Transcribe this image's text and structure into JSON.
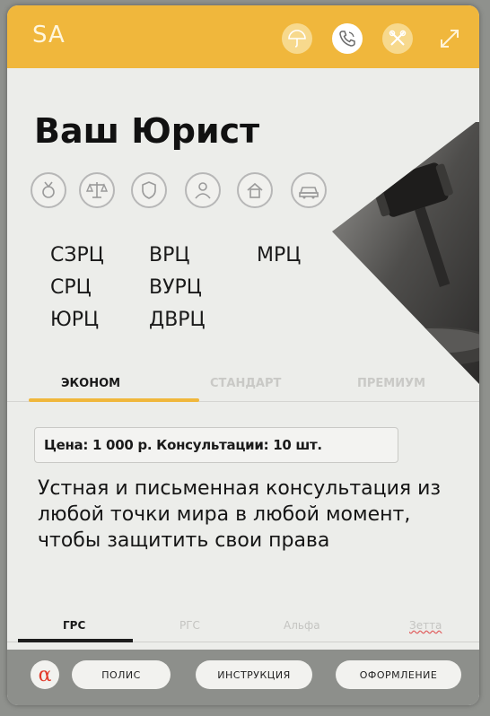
{
  "header": {
    "logo": "SA",
    "accent_color": "#f0b73c",
    "icons": [
      {
        "name": "umbrella-icon",
        "active": false
      },
      {
        "name": "phone-icon",
        "active": true
      },
      {
        "name": "tools-icon",
        "active": false
      }
    ],
    "expand_icon": "expand-arrows-icon"
  },
  "title": "Ваш Юрист",
  "service_icons": [
    "medal-icon",
    "scales-icon",
    "shield-icon",
    "person-icon",
    "house-icon",
    "car-icon"
  ],
  "regions": {
    "col1": [
      "СЗРЦ",
      "СРЦ",
      "ЮРЦ"
    ],
    "col2": [
      "ВРЦ",
      "ВУРЦ",
      "ДВРЦ"
    ],
    "col3": [
      "МРЦ"
    ]
  },
  "plan_tabs": [
    {
      "label": "ЭКОНОМ",
      "active": true
    },
    {
      "label": "СТАНДАРТ",
      "active": false
    },
    {
      "label": "ПРЕМИУМ",
      "active": false
    }
  ],
  "price_line": "Цена: 1 000 р.  Консультации: 10 шт.",
  "description": "Устная и письменная консультация из любой точки мира в любой момент, чтобы защитить свои права",
  "company_tabs": [
    {
      "label": "ГРС",
      "active": true
    },
    {
      "label": "РГС",
      "active": false
    },
    {
      "label": "Альфа",
      "active": false
    },
    {
      "label": "Зетта",
      "active": false
    }
  ],
  "footer": {
    "alpha_symbol": "α",
    "buttons": [
      "ПОЛИС",
      "ИНСТРУКЦИЯ",
      "ОФОРМЛЕНИЕ"
    ]
  }
}
